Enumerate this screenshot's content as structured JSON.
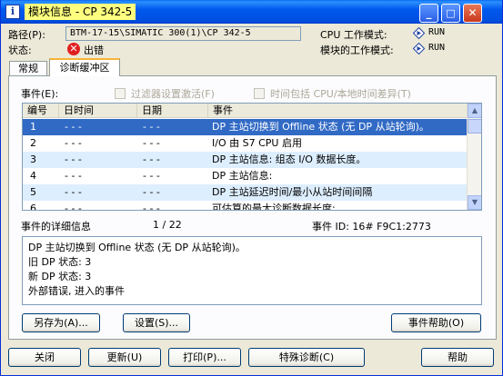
{
  "window": {
    "title": "模块信息 - CP 342-5",
    "minimize": "_",
    "maximize": "□",
    "close": "✕"
  },
  "header": {
    "path_label": "路径(P):",
    "path_value": "BTM-17-15\\SIMATIC 300(1)\\CP 342-5",
    "status_label": "状态:",
    "status_value": "出错",
    "cpu_mode_label": "CPU 工作模式:",
    "cpu_mode_value": "RUN",
    "module_mode_label": "模块的工作模式:",
    "module_mode_value": "RUN"
  },
  "tabs": [
    {
      "label": "常规"
    },
    {
      "label": "诊断缓冲区"
    }
  ],
  "events": {
    "label": "事件(E):",
    "filter_checkbox": "过滤器设置激活(F)",
    "timediff_checkbox": "时间包括 CPU/本地时间差异(T)",
    "columns": [
      "编号",
      "日时间",
      "日期",
      "事件"
    ],
    "rows": [
      {
        "no": "1",
        "time": "- - -",
        "date": "- - -",
        "event": "DP 主站切换到 Offline 状态 (无 DP 从站轮询)。"
      },
      {
        "no": "2",
        "time": "- - -",
        "date": "- - -",
        "event": "I/O 由 S7 CPU 启用"
      },
      {
        "no": "3",
        "time": "- - -",
        "date": "- - -",
        "event": "DP 主站信息: 组态 I/O 数据长度。"
      },
      {
        "no": "4",
        "time": "- - -",
        "date": "- - -",
        "event": "DP 主站信息:"
      },
      {
        "no": "5",
        "time": "- - -",
        "date": "- - -",
        "event": "DP 主站延迟时间/最小从站时间间隔"
      },
      {
        "no": "6",
        "time": "- - -",
        "date": "- - -",
        "event": "可估算的最大诊断数据长度:"
      }
    ]
  },
  "details": {
    "label": "事件的详细信息",
    "counter": "1 / 22",
    "event_id": "事件 ID: 16# F9C1:2773",
    "lines": [
      "DP 主站切换到 Offline 状态 (无 DP 从站轮询)。",
      "旧 DP 状态: 3",
      "新 DP 状态: 3",
      "外部错误, 进入的事件"
    ]
  },
  "panel_buttons": {
    "save_as": "另存为(A)...",
    "settings": "设置(S)...",
    "event_help": "事件帮助(O)"
  },
  "bottom_buttons": {
    "close": "关闭",
    "refresh": "更新(U)",
    "print": "打印(P)...",
    "special_diag": "特殊诊断(C)",
    "help": "帮助"
  }
}
